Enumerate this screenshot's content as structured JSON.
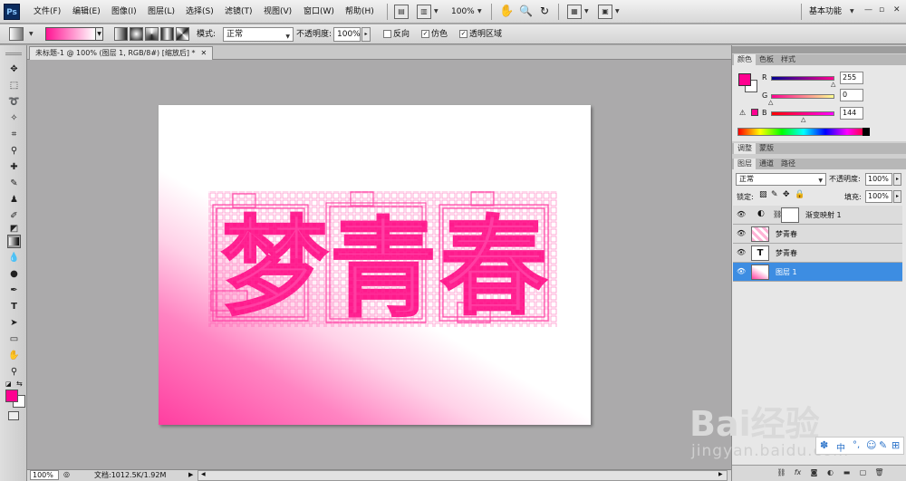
{
  "app": {
    "logo": "Ps",
    "workspace": "基本功能",
    "zoom_menu": "100%"
  },
  "menu": [
    "文件(F)",
    "编辑(E)",
    "图像(I)",
    "图层(L)",
    "选择(S)",
    "滤镜(T)",
    "视图(V)",
    "窗口(W)",
    "帮助(H)"
  ],
  "options": {
    "mode_label": "模式:",
    "mode_value": "正常",
    "opacity_label": "不透明度:",
    "opacity_value": "100%",
    "reverse_label": "反向",
    "dither_label": "仿色",
    "transparency_label": "透明区域",
    "reverse_checked": false,
    "dither_checked": true,
    "transparency_checked": true
  },
  "document": {
    "tab_title": "未标题-1 @ 100% (图层 1, RGB/8#) [缩放后] *",
    "text": "梦青春",
    "zoom": "100%",
    "doc_size": "文档:1012.5K/1.92M"
  },
  "color_panel": {
    "tabs": [
      "颜色",
      "色板",
      "样式"
    ],
    "r_label": "R",
    "g_label": "G",
    "b_label": "B",
    "r": "255",
    "g": "0",
    "b": "144",
    "foreground": "#ff0090",
    "background": "#ffffff"
  },
  "adjust_panel": {
    "tabs": [
      "调整",
      "蒙版"
    ]
  },
  "layers_panel": {
    "tabs": [
      "图层",
      "通道",
      "路径"
    ],
    "blend_mode": "正常",
    "opacity_label": "不透明度:",
    "opacity_value": "100%",
    "lock_label": "锁定:",
    "fill_label": "填充:",
    "fill_value": "100%",
    "layers": [
      {
        "name": "渐变映射 1",
        "type": "adjustment",
        "selected": false
      },
      {
        "name": "梦青春",
        "type": "pattern",
        "selected": false
      },
      {
        "name": "梦青春",
        "type": "text",
        "selected": false
      },
      {
        "name": "图层 1",
        "type": "gradient",
        "selected": true
      }
    ]
  },
  "toolbox": {
    "foreground": "#ff0090",
    "background": "#ffffff",
    "tools": [
      "move-tool",
      "marquee-tool",
      "lasso-tool",
      "magic-wand-tool",
      "crop-tool",
      "eyedropper-tool",
      "healing-brush-tool",
      "brush-tool",
      "clone-stamp-tool",
      "history-brush-tool",
      "eraser-tool",
      "gradient-tool",
      "blur-tool",
      "dodge-tool",
      "pen-tool",
      "type-tool",
      "path-selection-tool",
      "shape-tool",
      "hand-tool",
      "zoom-tool"
    ]
  },
  "watermark": {
    "brand": "Bai经验",
    "url": "jingyan.baidu.com"
  },
  "accent_color": "#ff1493",
  "selection_color": "#3d8de2"
}
